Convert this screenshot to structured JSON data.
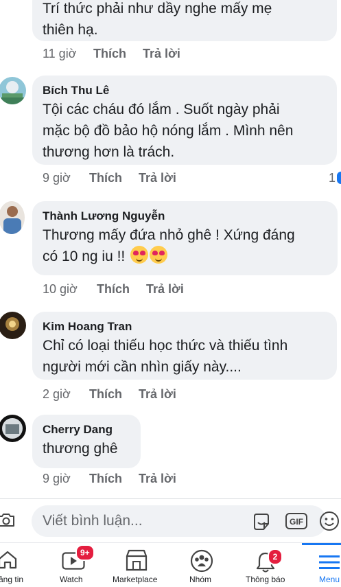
{
  "comments": [
    {
      "author": "",
      "text": "Trí thức phải như dầy nghe mấy mẹ\nthiên hạ.",
      "time": "11 giờ",
      "like": "Thích",
      "reply": "Trả lời",
      "reactions": ""
    },
    {
      "author": "Bích Thu Lê",
      "text": "Tội các cháu đó lắm . Suốt ngày phải\nmặc bộ đồ bảo hộ nóng lắm . Mình nên\nthương hơn là trách.",
      "time": "9 giờ",
      "like": "Thích",
      "reply": "Trả lời",
      "reactions": "1"
    },
    {
      "author": "Thành Lương Nguyễn",
      "text": "Thương mấy đứa nhỏ ghê ! Xứng đáng\ncó 10 ng iu !!",
      "time": "10 giờ",
      "like": "Thích",
      "reply": "Trả lời",
      "reactions": ""
    },
    {
      "author": "Kim Hoang Tran",
      "text": "Chỉ có loại thiếu học thức và thiếu tình\nngười mới cần nhìn giấy này....",
      "time": "2 giờ",
      "like": "Thích",
      "reply": "Trả lời",
      "reactions": ""
    },
    {
      "author": "Cherry Dang",
      "text": "thương ghê",
      "time": "9 giờ",
      "like": "Thích",
      "reply": "Trả lời",
      "reactions": ""
    }
  ],
  "composer": {
    "placeholder": "Viết bình luận..."
  },
  "nav": {
    "items": [
      {
        "label": "ảng tin",
        "icon": "home-icon"
      },
      {
        "label": "Watch",
        "icon": "watch-icon",
        "badge": "9+"
      },
      {
        "label": "Marketplace",
        "icon": "marketplace-icon"
      },
      {
        "label": "Nhóm",
        "icon": "groups-icon"
      },
      {
        "label": "Thông báo",
        "icon": "bell-icon",
        "badge": "2"
      },
      {
        "label": "Menu",
        "icon": "menu-icon"
      }
    ]
  },
  "colors": {
    "accent": "#1877f2",
    "badge": "#e41e3f",
    "bubble": "#eff1f4"
  }
}
